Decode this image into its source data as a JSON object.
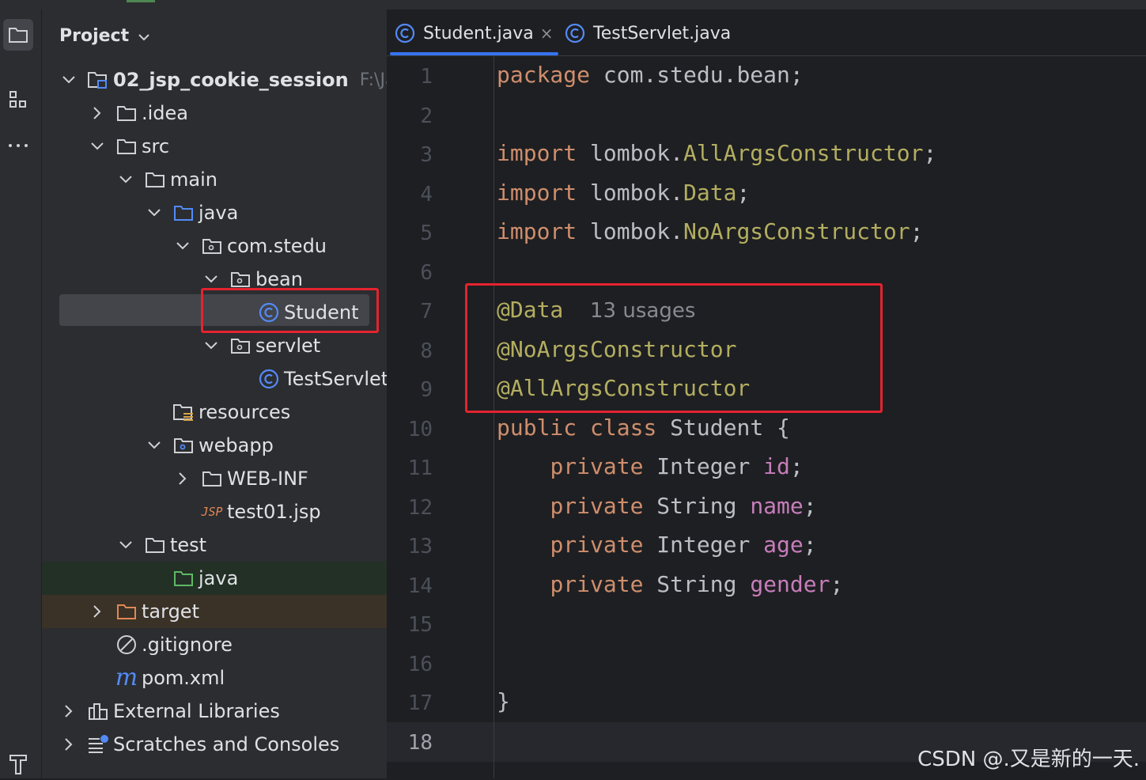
{
  "activity_bar": {
    "items": [
      {
        "name": "project-view-icon",
        "active": true
      },
      {
        "name": "structure-icon",
        "active": false
      },
      {
        "name": "more-icon",
        "active": false
      },
      {
        "name": "build-icon",
        "active": false
      }
    ]
  },
  "project_panel": {
    "title": "Project",
    "tree": [
      {
        "label": "02_jsp_cookie_session",
        "hint": "F:\\Jav",
        "icon": "module-folder-icon",
        "expanded": true,
        "bold": true
      },
      {
        "label": ".idea",
        "icon": "folder-icon",
        "expanded": false
      },
      {
        "label": "src",
        "icon": "folder-icon",
        "expanded": true
      },
      {
        "label": "main",
        "icon": "folder-icon",
        "expanded": true
      },
      {
        "label": "java",
        "icon": "source-folder-icon",
        "expanded": true
      },
      {
        "label": "com.stedu",
        "icon": "package-icon",
        "expanded": true
      },
      {
        "label": "bean",
        "icon": "package-icon",
        "expanded": true
      },
      {
        "label": "Student",
        "icon": "class-icon",
        "selected": true
      },
      {
        "label": "servlet",
        "icon": "package-icon",
        "expanded": true
      },
      {
        "label": "TestServlet",
        "icon": "class-icon"
      },
      {
        "label": "resources",
        "icon": "resources-folder-icon"
      },
      {
        "label": "webapp",
        "icon": "web-folder-icon",
        "expanded": true
      },
      {
        "label": "WEB-INF",
        "icon": "folder-icon",
        "expanded": false
      },
      {
        "label": "test01.jsp",
        "icon": "jsp-file-icon",
        "icon_text": "JSP"
      },
      {
        "label": "test",
        "icon": "folder-icon",
        "expanded": true
      },
      {
        "label": "java",
        "icon": "test-source-folder-icon"
      },
      {
        "label": "target",
        "icon": "excluded-folder-icon",
        "expanded": false
      },
      {
        "label": ".gitignore",
        "icon": "ignored-file-icon"
      },
      {
        "label": "pom.xml",
        "icon": "maven-file-icon",
        "icon_text": "m"
      },
      {
        "label": "External Libraries",
        "icon": "libraries-icon",
        "expanded": false
      },
      {
        "label": "Scratches and Consoles",
        "icon": "scratches-icon",
        "expanded": false
      }
    ]
  },
  "editor": {
    "tabs": [
      {
        "label": "Student.java",
        "active": true,
        "closable": true,
        "close_glyph": "×"
      },
      {
        "label": "TestServlet.java",
        "active": false
      }
    ],
    "current_line": 18,
    "lines": [
      {
        "num": "1",
        "tokens": [
          {
            "t": "package",
            "c": "kw"
          },
          {
            "t": " com.stedu.bean;",
            "c": ""
          }
        ]
      },
      {
        "num": "2",
        "tokens": []
      },
      {
        "num": "3",
        "tokens": [
          {
            "t": "import",
            "c": "kw"
          },
          {
            "t": " lombok.",
            "c": ""
          },
          {
            "t": "AllArgsConstructor",
            "c": "ann"
          },
          {
            "t": ";",
            "c": ""
          }
        ]
      },
      {
        "num": "4",
        "tokens": [
          {
            "t": "import",
            "c": "kw"
          },
          {
            "t": " lombok.",
            "c": ""
          },
          {
            "t": "Data",
            "c": "ann"
          },
          {
            "t": ";",
            "c": ""
          }
        ]
      },
      {
        "num": "5",
        "tokens": [
          {
            "t": "import",
            "c": "kw"
          },
          {
            "t": " lombok.",
            "c": ""
          },
          {
            "t": "NoArgsConstructor",
            "c": "ann"
          },
          {
            "t": ";",
            "c": ""
          }
        ]
      },
      {
        "num": "6",
        "tokens": []
      },
      {
        "num": "7",
        "tokens": [
          {
            "t": "@Data",
            "c": "ann"
          },
          {
            "t": "  ",
            "c": ""
          },
          {
            "t": "13 usages",
            "c": "usages"
          }
        ]
      },
      {
        "num": "8",
        "tokens": [
          {
            "t": "@NoArgsConstructor",
            "c": "ann"
          }
        ]
      },
      {
        "num": "9",
        "tokens": [
          {
            "t": "@AllArgsConstructor",
            "c": "ann"
          }
        ]
      },
      {
        "num": "10",
        "tokens": [
          {
            "t": "public",
            "c": "kw"
          },
          {
            "t": " ",
            "c": ""
          },
          {
            "t": "class",
            "c": "kw"
          },
          {
            "t": " Student {",
            "c": ""
          }
        ]
      },
      {
        "num": "11",
        "tokens": [
          {
            "t": "    ",
            "c": ""
          },
          {
            "t": "private",
            "c": "kw"
          },
          {
            "t": " Integer ",
            "c": ""
          },
          {
            "t": "id",
            "c": "fld"
          },
          {
            "t": ";",
            "c": ""
          }
        ]
      },
      {
        "num": "12",
        "tokens": [
          {
            "t": "    ",
            "c": ""
          },
          {
            "t": "private",
            "c": "kw"
          },
          {
            "t": " String ",
            "c": ""
          },
          {
            "t": "name",
            "c": "fld"
          },
          {
            "t": ";",
            "c": ""
          }
        ]
      },
      {
        "num": "13",
        "tokens": [
          {
            "t": "    ",
            "c": ""
          },
          {
            "t": "private",
            "c": "kw"
          },
          {
            "t": " Integer ",
            "c": ""
          },
          {
            "t": "age",
            "c": "fld"
          },
          {
            "t": ";",
            "c": ""
          }
        ]
      },
      {
        "num": "14",
        "tokens": [
          {
            "t": "    ",
            "c": ""
          },
          {
            "t": "private",
            "c": "kw"
          },
          {
            "t": " String ",
            "c": ""
          },
          {
            "t": "gender",
            "c": "fld"
          },
          {
            "t": ";",
            "c": ""
          }
        ]
      },
      {
        "num": "15",
        "tokens": []
      },
      {
        "num": "16",
        "tokens": []
      },
      {
        "num": "17",
        "tokens": [
          {
            "t": "}",
            "c": ""
          }
        ]
      },
      {
        "num": "18",
        "tokens": []
      }
    ]
  },
  "watermark": "CSDN @.又是新的一天.",
  "colors": {
    "keyword": "#cf8e6d",
    "annotation": "#b3ae60",
    "field": "#c77dbb",
    "highlight_box": "#e5232f",
    "tab_accent": "#3574f0"
  }
}
